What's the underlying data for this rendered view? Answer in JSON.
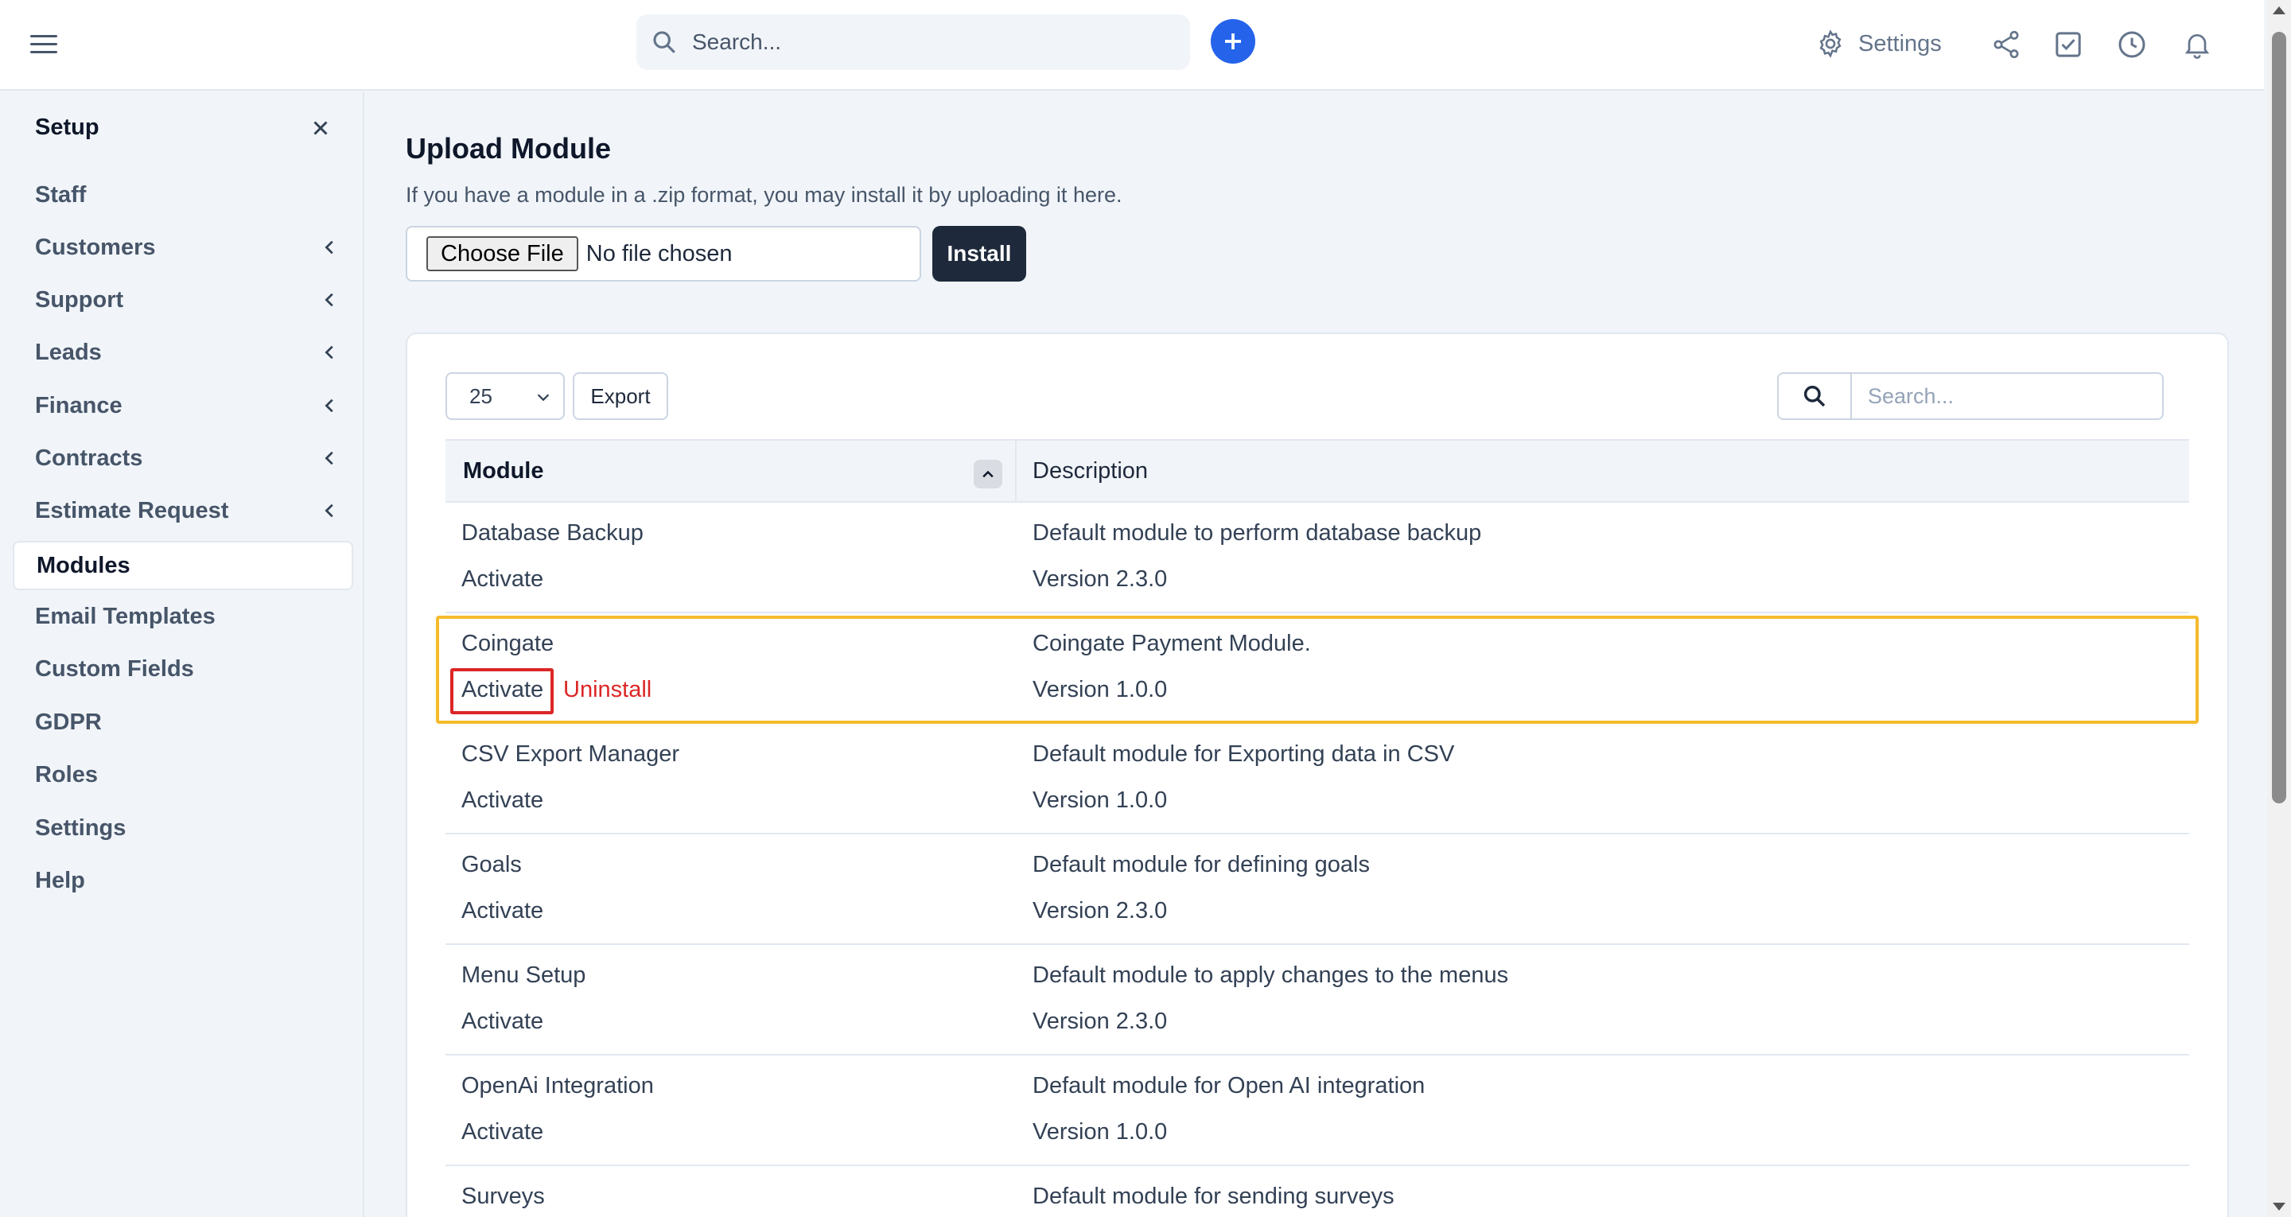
{
  "header": {
    "search_placeholder": "Search...",
    "settings_label": "Settings"
  },
  "sidebar": {
    "title": "Setup",
    "items": [
      {
        "label": "Staff",
        "has_submenu": false,
        "active": false
      },
      {
        "label": "Customers",
        "has_submenu": true,
        "active": false
      },
      {
        "label": "Support",
        "has_submenu": true,
        "active": false
      },
      {
        "label": "Leads",
        "has_submenu": true,
        "active": false
      },
      {
        "label": "Finance",
        "has_submenu": true,
        "active": false
      },
      {
        "label": "Contracts",
        "has_submenu": true,
        "active": false
      },
      {
        "label": "Estimate Request",
        "has_submenu": true,
        "active": false
      },
      {
        "label": "Modules",
        "has_submenu": false,
        "active": true
      },
      {
        "label": "Email Templates",
        "has_submenu": false,
        "active": false
      },
      {
        "label": "Custom Fields",
        "has_submenu": false,
        "active": false
      },
      {
        "label": "GDPR",
        "has_submenu": false,
        "active": false
      },
      {
        "label": "Roles",
        "has_submenu": false,
        "active": false
      },
      {
        "label": "Settings",
        "has_submenu": false,
        "active": false
      },
      {
        "label": "Help",
        "has_submenu": false,
        "active": false
      }
    ]
  },
  "upload": {
    "title": "Upload Module",
    "subtitle": "If you have a module in a .zip format, you may install it by uploading it here.",
    "choose_file_label": "Choose File",
    "file_status": "No file chosen",
    "install_label": "Install"
  },
  "table": {
    "per_page": "25",
    "export_label": "Export",
    "search_placeholder": "Search...",
    "columns": [
      "Module",
      "Description"
    ],
    "rows": [
      {
        "name": "Database Backup",
        "action": "Activate",
        "uninstall": "",
        "description": "Default module to perform database backup",
        "version": "Version 2.3.0"
      },
      {
        "name": "Coingate",
        "action": "Activate",
        "uninstall": "Uninstall",
        "description": "Coingate Payment Module.",
        "version": "Version 1.0.0"
      },
      {
        "name": "CSV Export Manager",
        "action": "Activate",
        "uninstall": "",
        "description": "Default module for Exporting data in CSV",
        "version": "Version 1.0.0"
      },
      {
        "name": "Goals",
        "action": "Activate",
        "uninstall": "",
        "description": "Default module for defining goals",
        "version": "Version 2.3.0"
      },
      {
        "name": "Menu Setup",
        "action": "Activate",
        "uninstall": "",
        "description": "Default module to apply changes to the menus",
        "version": "Version 2.3.0"
      },
      {
        "name": "OpenAi Integration",
        "action": "Activate",
        "uninstall": "",
        "description": "Default module for Open AI integration",
        "version": "Version 1.0.0"
      },
      {
        "name": "Surveys",
        "action": "",
        "uninstall": "",
        "description": "Default module for sending surveys",
        "version": ""
      }
    ]
  },
  "colors": {
    "accent": "#2563eb",
    "highlight_row": "#f4bb2c",
    "highlight_action": "#dc2626",
    "uninstall": "#dc2626",
    "install_button": "#1e293b"
  }
}
